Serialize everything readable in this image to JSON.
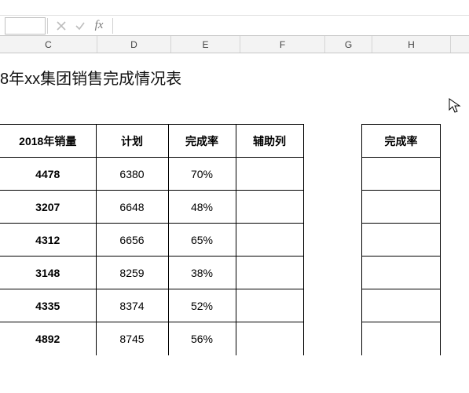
{
  "ribbon": {
    "hints": [
      "",
      ""
    ]
  },
  "formula_bar": {
    "name_box": "",
    "cancel_tip": "Cancel",
    "enter_tip": "Enter",
    "fx_label": "fx",
    "formula_value": ""
  },
  "columns": {
    "C": "C",
    "D": "D",
    "E": "E",
    "F": "F",
    "G": "G",
    "H": "H"
  },
  "title": "8年xx集团销售完成情况表",
  "table": {
    "headers": {
      "sales": "2018年销量",
      "plan": "计划",
      "rate": "完成率",
      "aux": "辅助列"
    },
    "rows": [
      {
        "sales": "4478",
        "plan": "6380",
        "rate": "70%",
        "aux": ""
      },
      {
        "sales": "3207",
        "plan": "6648",
        "rate": "48%",
        "aux": ""
      },
      {
        "sales": "4312",
        "plan": "6656",
        "rate": "65%",
        "aux": ""
      },
      {
        "sales": "3148",
        "plan": "8259",
        "rate": "38%",
        "aux": ""
      },
      {
        "sales": "4335",
        "plan": "8374",
        "rate": "52%",
        "aux": ""
      },
      {
        "sales": "4892",
        "plan": "8745",
        "rate": "56%",
        "aux": ""
      }
    ]
  },
  "side": {
    "header": "完成率",
    "rows": [
      "",
      "",
      "",
      "",
      "",
      ""
    ]
  },
  "chart_data": {
    "type": "table",
    "title": "8年xx集团销售完成情况表",
    "columns": [
      "2018年销量",
      "计划",
      "完成率",
      "辅助列"
    ],
    "rows": [
      [
        4478,
        6380,
        0.7,
        null
      ],
      [
        3207,
        6648,
        0.48,
        null
      ],
      [
        4312,
        6656,
        0.65,
        null
      ],
      [
        3148,
        8259,
        0.38,
        null
      ],
      [
        4335,
        8374,
        0.52,
        null
      ],
      [
        4892,
        8745,
        0.56,
        null
      ]
    ]
  }
}
